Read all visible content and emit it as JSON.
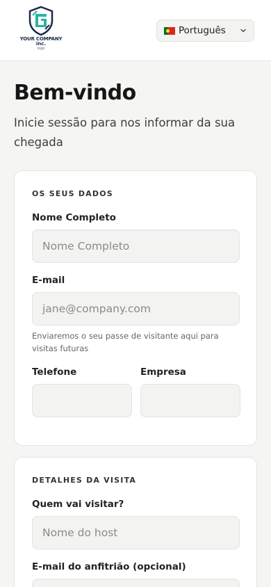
{
  "header": {
    "logo": {
      "line1": "YOUR COMPANY",
      "line2": "inc.",
      "line3": "logo"
    },
    "language": {
      "label": "Português",
      "flag": "portugal-flag-icon"
    }
  },
  "page": {
    "title": "Bem-vindo",
    "subtitle": "Inicie sessão para nos informar da sua chegada"
  },
  "your_details": {
    "section_title": "OS SEUS DADOS",
    "full_name": {
      "label": "Nome Completo",
      "placeholder": "Nome Completo",
      "value": ""
    },
    "email": {
      "label": "E-mail",
      "placeholder": "jane@company.com",
      "value": "",
      "hint": "Enviaremos o seu passe de visitante aqui para visitas futuras"
    },
    "phone": {
      "label": "Telefone",
      "value": ""
    },
    "company": {
      "label": "Empresa",
      "value": ""
    }
  },
  "visit_details": {
    "section_title": "DETALHES DA VISITA",
    "host": {
      "label": "Quem vai visitar?",
      "placeholder": "Nome do host",
      "value": ""
    },
    "host_email": {
      "label": "E-mail do anfitrião (opcional)",
      "value": ""
    }
  },
  "colors": {
    "background": "#f5f5f3",
    "card": "#ffffff",
    "input_bg": "#f3f3f1",
    "text": "#1d1d1d",
    "logo_primary": "#1b2a4a",
    "logo_accent": "#2bb3a3"
  }
}
